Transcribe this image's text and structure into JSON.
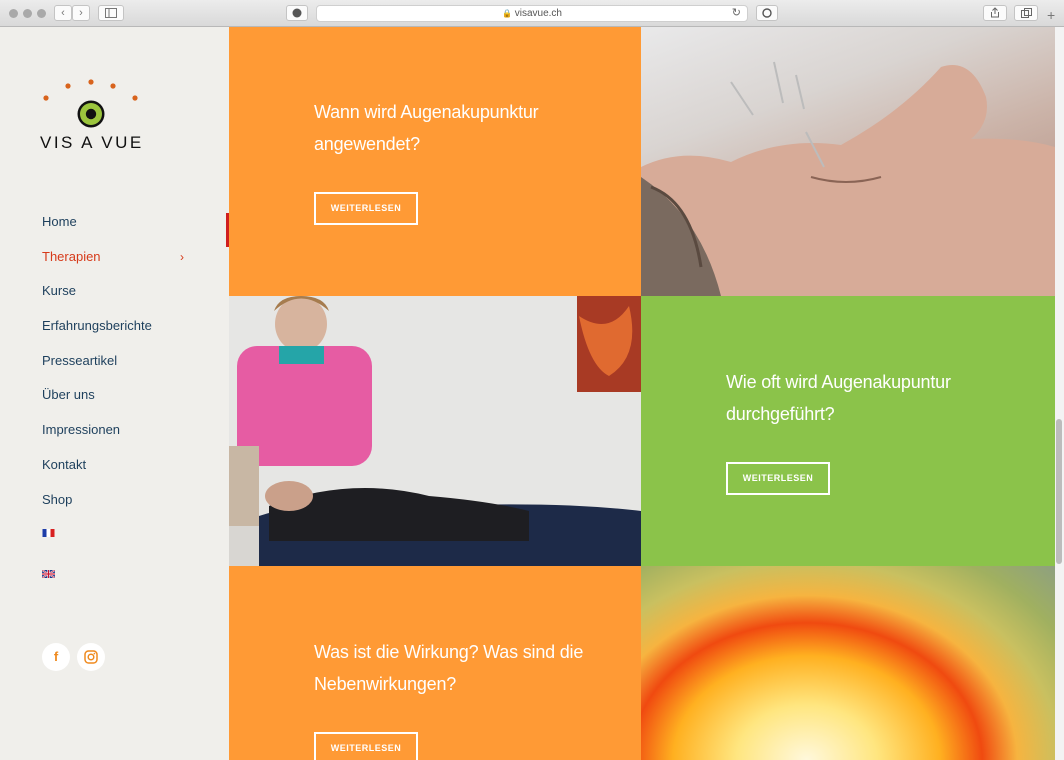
{
  "browser": {
    "url": "visavue.ch",
    "back_label": "‹",
    "forward_label": "›"
  },
  "sidebar": {
    "logo_text": "VIS A VUE",
    "menu": [
      {
        "label": "Home",
        "active": false
      },
      {
        "label": "Therapien",
        "active": true
      },
      {
        "label": "Kurse",
        "active": false
      },
      {
        "label": "Erfahrungsberichte",
        "active": false
      },
      {
        "label": "Presseartikel",
        "active": false
      },
      {
        "label": "Über uns",
        "active": false
      },
      {
        "label": "Impressionen",
        "active": false
      },
      {
        "label": "Kontakt",
        "active": false
      },
      {
        "label": "Shop",
        "active": false
      }
    ],
    "languages": [
      "french-flag-icon",
      "uk-flag-icon"
    ],
    "social": [
      {
        "icon": "facebook-icon",
        "glyph": "f"
      },
      {
        "icon": "instagram-icon",
        "glyph": "◎"
      }
    ]
  },
  "tiles": [
    {
      "heading": "Wann wird Augenakupunktur angewendet?",
      "button": "WEITERLESEN",
      "color": "#ff9933"
    },
    {
      "heading": "Wie oft wird Augenakupuntur durchgeführt?",
      "button": "WEITERLESEN",
      "color": "#8bc34a"
    },
    {
      "heading": "Was ist die Wirkung? Was sind die Nebenwirkungen?",
      "button": "WEITERLESEN",
      "color": "#ff9933"
    }
  ],
  "colors": {
    "orange": "#ff9933",
    "green": "#8bc34a",
    "navy_text": "#1d3f5c",
    "active_red": "#d63a1a",
    "sidebar_bg": "#f0efeb"
  }
}
